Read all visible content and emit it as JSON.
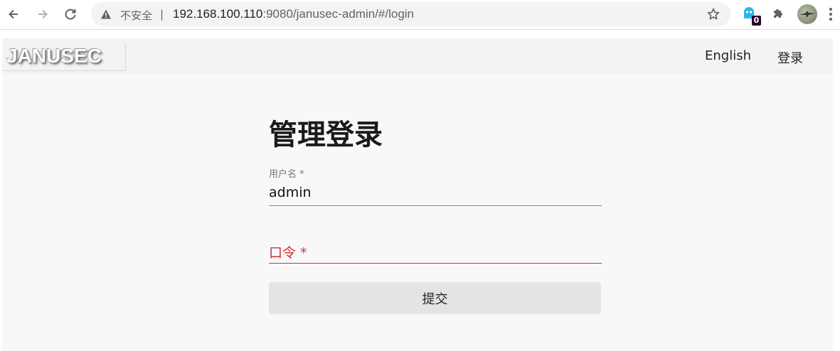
{
  "browser": {
    "security_label": "不安全",
    "separator": "|",
    "url_host": "192.168.100.110",
    "url_rest": ":9080/janusec-admin/#/login",
    "extension_badge": "0",
    "icons": [
      "back-arrow-icon",
      "forward-arrow-icon",
      "reload-icon",
      "warning-icon",
      "star-icon",
      "ghost-extension-icon",
      "puzzle-icon",
      "profile-avatar",
      "kebab-menu-icon"
    ]
  },
  "header": {
    "brand": "JANUSEC",
    "nav": {
      "language": "English",
      "login": "登录"
    }
  },
  "form": {
    "title": "管理登录",
    "username_label": "用户名 *",
    "username_value": "admin",
    "password_label": "口令 *",
    "submit_label": "提交"
  },
  "colors": {
    "error": "#d32f2f",
    "page_bg": "#f8f8f8",
    "button_bg": "#e4e4e4"
  }
}
